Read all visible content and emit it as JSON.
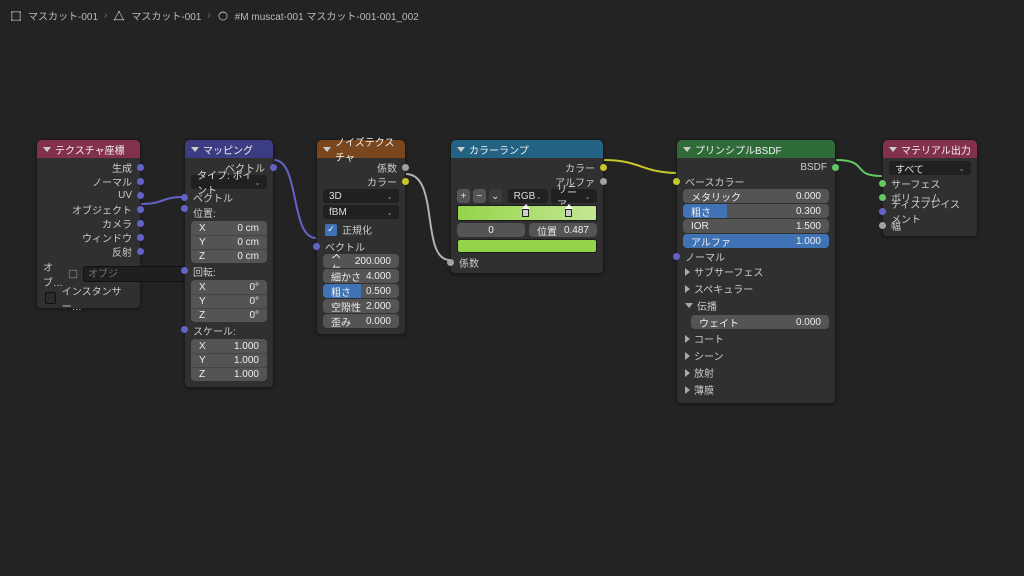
{
  "breadcrumb": {
    "items": [
      {
        "label": "マスカット-001"
      },
      {
        "label": "マスカット-001"
      },
      {
        "label": "#M muscat-001 マスカット-001-001_002"
      }
    ]
  },
  "tex_coord": {
    "title": "テクスチャ座標",
    "color": "#83314a",
    "outputs": [
      "生成",
      "ノーマル",
      "UV",
      "オブジェクト",
      "カメラ",
      "ウィンドウ",
      "反射"
    ],
    "object_label": "オブ…",
    "object_placeholder": "オブジ",
    "instancer_label": "インスタンサー…"
  },
  "mapping": {
    "title": "マッピング",
    "color": "#3c3c83",
    "out": "ベクトル",
    "type_label": "タイプ:",
    "type_value": "ポイント",
    "in": "ベクトル",
    "loc_label": "位置:",
    "loc": {
      "x": "X",
      "xv": "0 cm",
      "y": "Y",
      "yv": "0 cm",
      "z": "Z",
      "zv": "0 cm"
    },
    "rot_label": "回転:",
    "rot": {
      "x": "X",
      "xv": "0°",
      "y": "Y",
      "yv": "0°",
      "z": "Z",
      "zv": "0°"
    },
    "scale_label": "スケール:",
    "scale": {
      "x": "X",
      "xv": "1.000",
      "y": "Y",
      "yv": "1.000",
      "z": "Z",
      "zv": "1.000"
    }
  },
  "noise": {
    "title": "ノイズテクスチャ",
    "color": "#79461d",
    "out_fac": "係数",
    "out_color": "カラー",
    "dim": "3D",
    "mode": "fBM",
    "normalize": "正規化",
    "in_vec": "ベクトル",
    "scale_l": "スケ…",
    "scale_v": "200.000",
    "detail_l": "細かさ",
    "detail_v": "4.000",
    "rough_l": "粗さ",
    "rough_v": "0.500",
    "lac_l": "空隙性",
    "lac_v": "2.000",
    "dist_l": "歪み",
    "dist_v": "0.000"
  },
  "ramp": {
    "title": "カラーランプ",
    "color": "#246283",
    "out_color": "カラー",
    "out_alpha": "アルファ",
    "mode_rgb": "RGB",
    "interp": "リニア",
    "idx": "0",
    "pos_l": "位置",
    "pos_v": "0.487",
    "in_fac": "係数",
    "stops": [
      0.487,
      0.8
    ]
  },
  "bsdf": {
    "title": "プリンシプルBSDF",
    "color": "#2f6b39",
    "out": "BSDF",
    "base_color": "ベースカラー",
    "metallic_l": "メタリック",
    "metallic_v": "0.000",
    "rough_l": "粗さ",
    "rough_v": "0.300",
    "ior_l": "IOR",
    "ior_v": "1.500",
    "alpha_l": "アルファ",
    "alpha_v": "1.000",
    "normal": "ノーマル",
    "panels1": [
      "サブサーフェス",
      "スペキュラー"
    ],
    "panel_open": "伝播",
    "weight_l": "ウェイト",
    "weight_v": "0.000",
    "panels2": [
      "コート",
      "シーン",
      "放射",
      "薄膜"
    ]
  },
  "output": {
    "title": "マテリアル出力",
    "color": "#83314a",
    "target": "すべて",
    "surface": "サーフェス",
    "volume": "ボリューム",
    "disp": "ディスプレイスメント",
    "thick": "幅"
  }
}
